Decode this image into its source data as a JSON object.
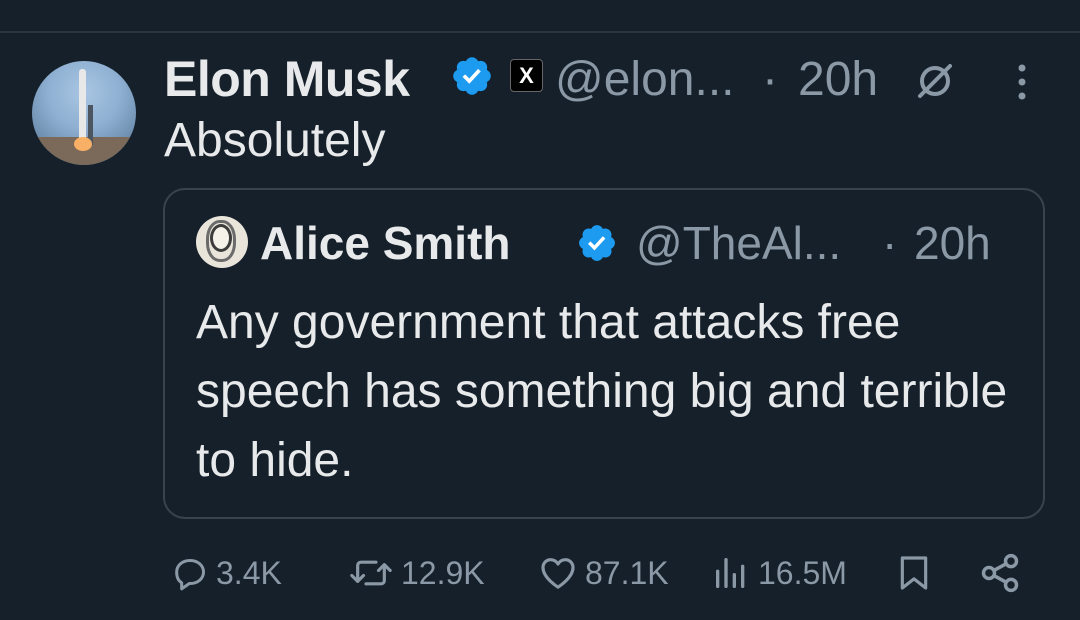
{
  "tweet": {
    "author_name": "Elon Musk",
    "x_badge": "X",
    "handle": "@elon...",
    "separator": "·",
    "time": "20h",
    "text": "Absolutely"
  },
  "quoted_tweet": {
    "author_name": "Alice Smith",
    "handle": "@TheAl...",
    "separator": "·",
    "time": "20h",
    "text": "Any government that attacks free speech has something big and terrible to hide."
  },
  "actions": {
    "replies": "3.4K",
    "reposts": "12.9K",
    "likes": "87.1K",
    "views": "16.5M"
  },
  "colors": {
    "background": "#15202b",
    "verified_blue": "#1d9bf0",
    "muted_text": "#8b98a5",
    "primary_text": "#e7e9ea"
  }
}
